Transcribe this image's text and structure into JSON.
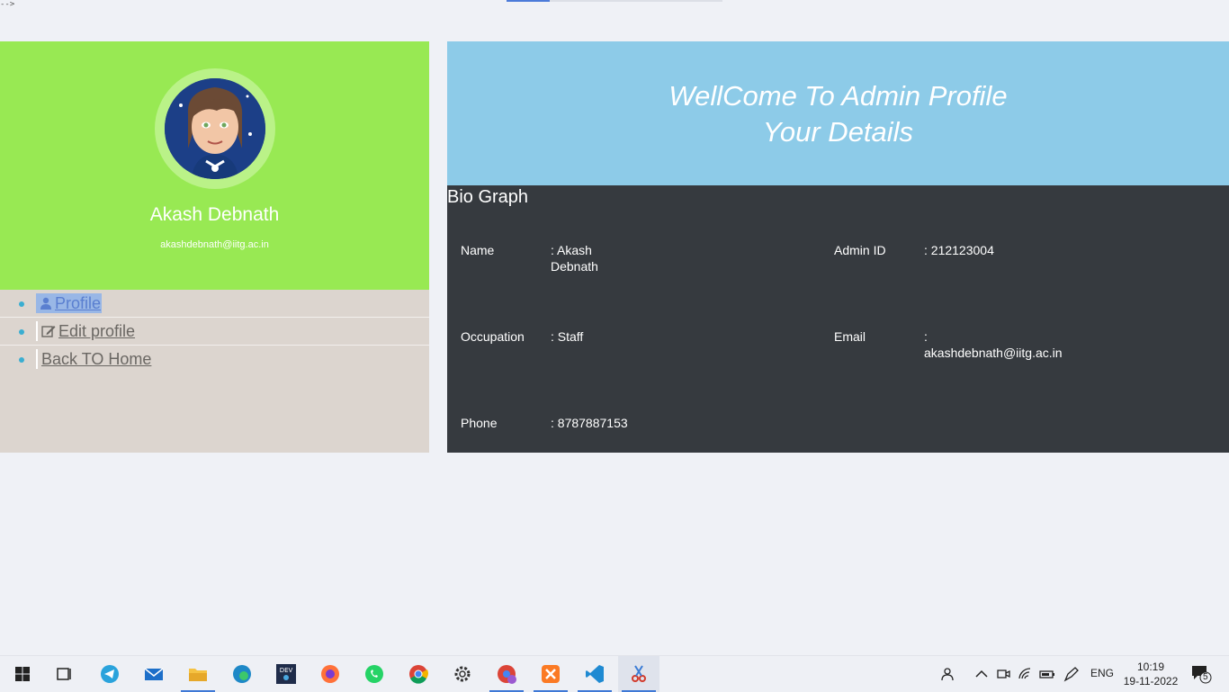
{
  "page": {
    "stray_text": "-->"
  },
  "profile": {
    "name": "Akash Debnath",
    "email": "akashdebnath@iitg.ac.in"
  },
  "menu": {
    "items": [
      {
        "label": "Profile",
        "icon": "user-icon",
        "active": true
      },
      {
        "label": "Edit profile",
        "icon": "edit-icon",
        "active": false
      },
      {
        "label": "Back TO Home",
        "icon": "",
        "active": false
      }
    ]
  },
  "header": {
    "line1": "WellCome To Admin Profile",
    "line2": "Your Details"
  },
  "bio": {
    "title": "Bio Graph",
    "fields": {
      "name": {
        "label": "Name",
        "value": ": Akash Debnath"
      },
      "admin_id": {
        "label": "Admin ID",
        "value": ": 212123004"
      },
      "occupation": {
        "label": "Occupation",
        "value": ": Staff"
      },
      "email": {
        "label": "Email",
        "value": ": akashdebnath@iitg.ac.in"
      },
      "phone": {
        "label": "Phone",
        "value": ": 8787887153"
      }
    }
  },
  "taskbar": {
    "apps": [
      "start-icon",
      "task-view-icon",
      "telegram-icon",
      "mail-icon",
      "file-explorer-icon",
      "edge-icon",
      "dev-icon",
      "firefox-icon",
      "whatsapp-icon",
      "chrome-icon",
      "settings-icon",
      "chrome-profile-icon",
      "xampp-icon",
      "vscode-icon",
      "snipping-tool-icon"
    ],
    "language": "ENG",
    "time": "10:19",
    "date": "19-11-2022",
    "notifications": "5"
  },
  "colors": {
    "profile_bg": "#98e953",
    "menu_bg": "#dcd5cf",
    "header_bg": "#8dcbe8",
    "bio_bg": "#363a3f",
    "bullet": "#3aaed1"
  }
}
